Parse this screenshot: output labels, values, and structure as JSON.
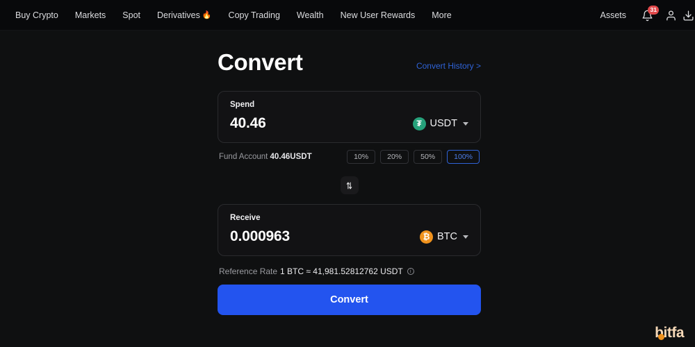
{
  "navbar": {
    "items": [
      {
        "label": "Buy Crypto",
        "emoji": ""
      },
      {
        "label": "Markets",
        "emoji": ""
      },
      {
        "label": "Spot",
        "emoji": ""
      },
      {
        "label": "Derivatives",
        "emoji": "🔥"
      },
      {
        "label": "Copy Trading",
        "emoji": ""
      },
      {
        "label": "Wealth",
        "emoji": ""
      },
      {
        "label": "New User Rewards",
        "emoji": ""
      },
      {
        "label": "More",
        "emoji": ""
      }
    ],
    "assets_label": "Assets",
    "notification_count": "31"
  },
  "header": {
    "title": "Convert",
    "history_link": "Convert History >"
  },
  "spend": {
    "label": "Spend",
    "amount": "40.46",
    "coin": "USDT",
    "coin_symbol": "₮"
  },
  "fund": {
    "prefix": "Fund Account ",
    "balance": "40.46USDT",
    "percentages": [
      "10%",
      "20%",
      "50%",
      "100%"
    ],
    "active_percentage": "100%"
  },
  "receive": {
    "label": "Receive",
    "amount": "0.000963",
    "coin": "BTC",
    "coin_symbol": "₿"
  },
  "rate": {
    "label": "Reference Rate",
    "value": "1 BTC ≈ 41,981.52812762 USDT",
    "info_glyph": "i"
  },
  "actions": {
    "convert_label": "Convert"
  },
  "watermark": {
    "text": "bitfa"
  },
  "colors": {
    "page_bg": "#0f1011",
    "navbar_bg": "#08090b",
    "card_bg": "#121214",
    "accent_blue": "#2354ef",
    "link_blue": "#2f63d8",
    "usdt_green": "#26a17b",
    "btc_orange": "#f0921d",
    "badge_red": "#e2494b"
  }
}
